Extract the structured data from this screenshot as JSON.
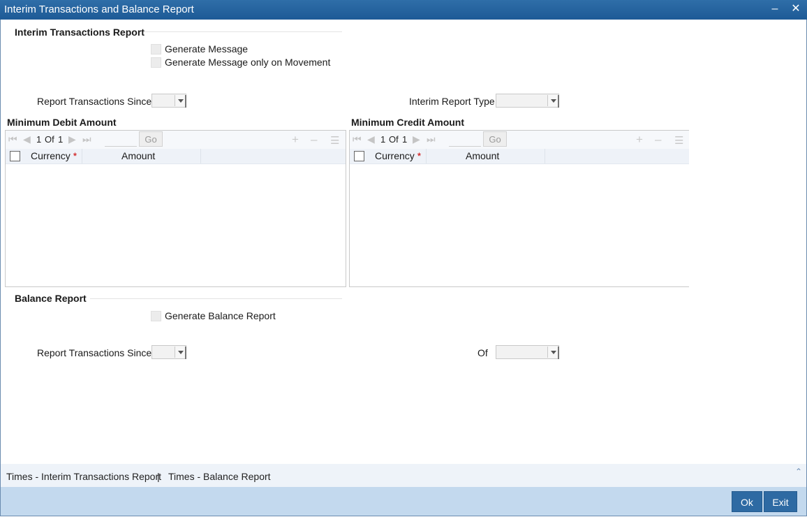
{
  "window": {
    "title": "Interim Transactions and Balance Report",
    "minimize_glyph": "‒",
    "close_glyph": "✕"
  },
  "interim": {
    "heading": "Interim Transactions Report",
    "generate_message": "Generate Message",
    "generate_message_movement": "Generate Message only on Movement",
    "report_since_label": "Report Transactions Since",
    "report_type_label": "Interim Report Type"
  },
  "debit": {
    "heading": "Minimum Debit Amount",
    "page_current": "1",
    "page_of": "Of",
    "page_total": "1",
    "go": "Go",
    "col_currency": "Currency",
    "col_amount": "Amount",
    "required": "*"
  },
  "credit": {
    "heading": "Minimum Credit Amount",
    "page_current": "1",
    "page_of": "Of",
    "page_total": "1",
    "go": "Go",
    "col_currency": "Currency",
    "col_amount": "Amount",
    "required": "*"
  },
  "balance": {
    "heading": "Balance Report",
    "generate_balance": "Generate Balance Report",
    "report_since_label": "Report Transactions Since",
    "of_label": "Of"
  },
  "footer": {
    "link1": "Times - Interim Transactions Report",
    "separator": "|",
    "link2": "Times - Balance Report",
    "ok": "Ok",
    "exit": "Exit"
  }
}
